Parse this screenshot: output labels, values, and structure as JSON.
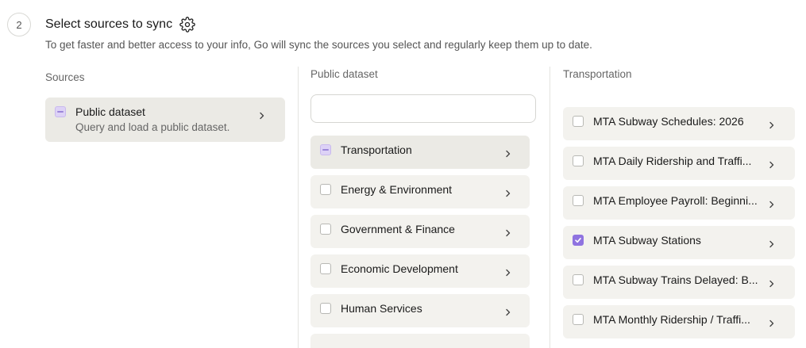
{
  "step": {
    "number": "2",
    "title": "Select sources to sync",
    "subtitle": "To get faster and better access to your info, Go will sync the sources you select and regularly keep them up to date."
  },
  "columns": {
    "sources": {
      "label": "Sources",
      "items": [
        {
          "label": "Public dataset",
          "description": "Query and load a public dataset.",
          "state": "partial"
        }
      ]
    },
    "public_dataset": {
      "label": "Public dataset",
      "search": {
        "value": "",
        "placeholder": ""
      },
      "items": [
        {
          "label": "Transportation",
          "state": "partial"
        },
        {
          "label": "Energy & Environment",
          "state": "unchecked"
        },
        {
          "label": "Government & Finance",
          "state": "unchecked"
        },
        {
          "label": "Economic Development",
          "state": "unchecked"
        },
        {
          "label": "Human Services",
          "state": "unchecked"
        }
      ]
    },
    "transportation": {
      "label": "Transportation",
      "items": [
        {
          "label": "MTA Subway Schedules: 2026",
          "state": "unchecked"
        },
        {
          "label": "MTA Daily Ridership and Traffi...",
          "state": "unchecked"
        },
        {
          "label": "MTA Employee Payroll: Beginni...",
          "state": "unchecked"
        },
        {
          "label": "MTA Subway Stations",
          "state": "checked"
        },
        {
          "label": "MTA Subway Trains Delayed: B...",
          "state": "unchecked"
        },
        {
          "label": "MTA Monthly Ridership / Traffi...",
          "state": "unchecked"
        }
      ]
    }
  },
  "icons": {
    "settings": "gear-icon",
    "search": "search-icon",
    "chevron": "chevron-right-icon"
  },
  "colors": {
    "accent": "#8f73e0",
    "card_bg": "#f3f2ee",
    "card_active_bg": "#ebeae5"
  }
}
